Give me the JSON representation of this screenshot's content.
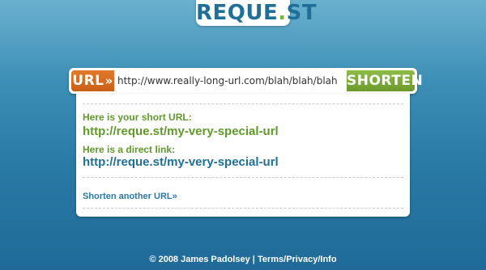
{
  "logo": {
    "text_before": "REQUE",
    "dot": ".",
    "text_after": "ST"
  },
  "urlbar": {
    "label": "URL",
    "chevrons": "»",
    "value": "http://www.really-long-url.com/blah/blah/blah",
    "button_label": "SHORTEN"
  },
  "result": {
    "short_label": "Here is your short URL:",
    "short_url": "http://reque.st/my-very-special-url",
    "direct_label": "Here is a direct link:",
    "direct_url": "http://reque.st/my-very-special-url",
    "another_link": "Shorten another URL»"
  },
  "footer": {
    "copyright": "© 2008 James Padolsey",
    "separator": " | ",
    "links_label": "Terms/Privacy/Info"
  },
  "colors": {
    "background_top": "#6ab0cf",
    "background_bottom": "#1f6a98",
    "url_label_orange": "#d96e20",
    "shorten_green": "#7fad3a",
    "label_green": "#5f9a2a",
    "link_blue": "#1f6f99"
  }
}
